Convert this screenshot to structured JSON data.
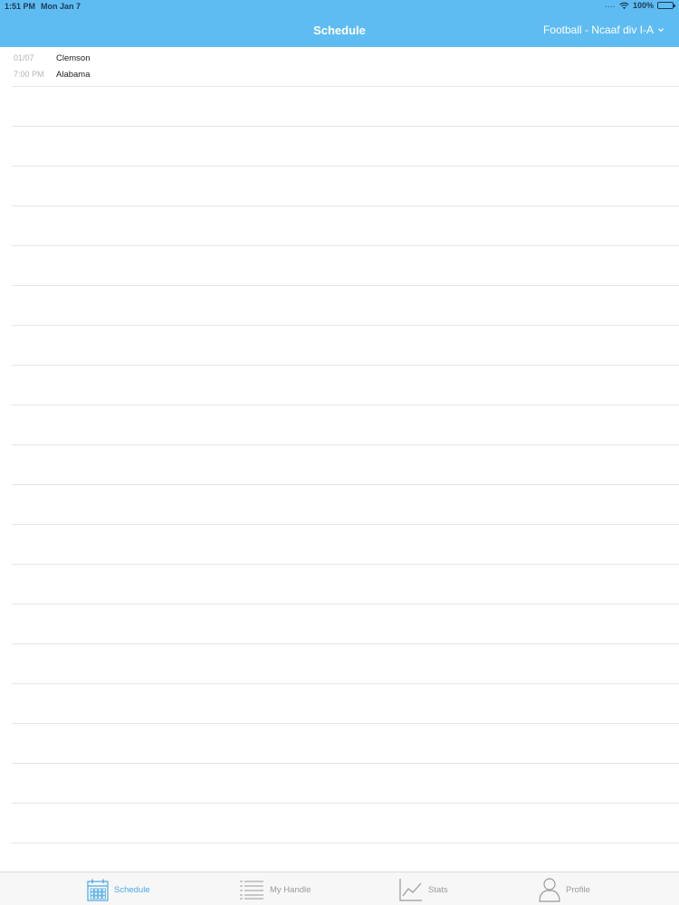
{
  "status_bar": {
    "time": "1:51 PM",
    "date": "Mon Jan 7",
    "signal": "....",
    "battery": "100%"
  },
  "header": {
    "title": "Schedule",
    "league": "Football - Ncaaf div I-A",
    "accent_color": "#5fbcf3"
  },
  "games": [
    {
      "date": "01/07",
      "time": "7:00 PM",
      "team_home": "Clemson",
      "team_away": "Alabama"
    }
  ],
  "tabs": [
    {
      "label": "Schedule",
      "icon": "calendar-icon",
      "active": true
    },
    {
      "label": "My Handle",
      "icon": "list-icon",
      "active": false
    },
    {
      "label": "Stats",
      "icon": "chart-icon",
      "active": false
    },
    {
      "label": "Profile",
      "icon": "person-icon",
      "active": false
    }
  ]
}
